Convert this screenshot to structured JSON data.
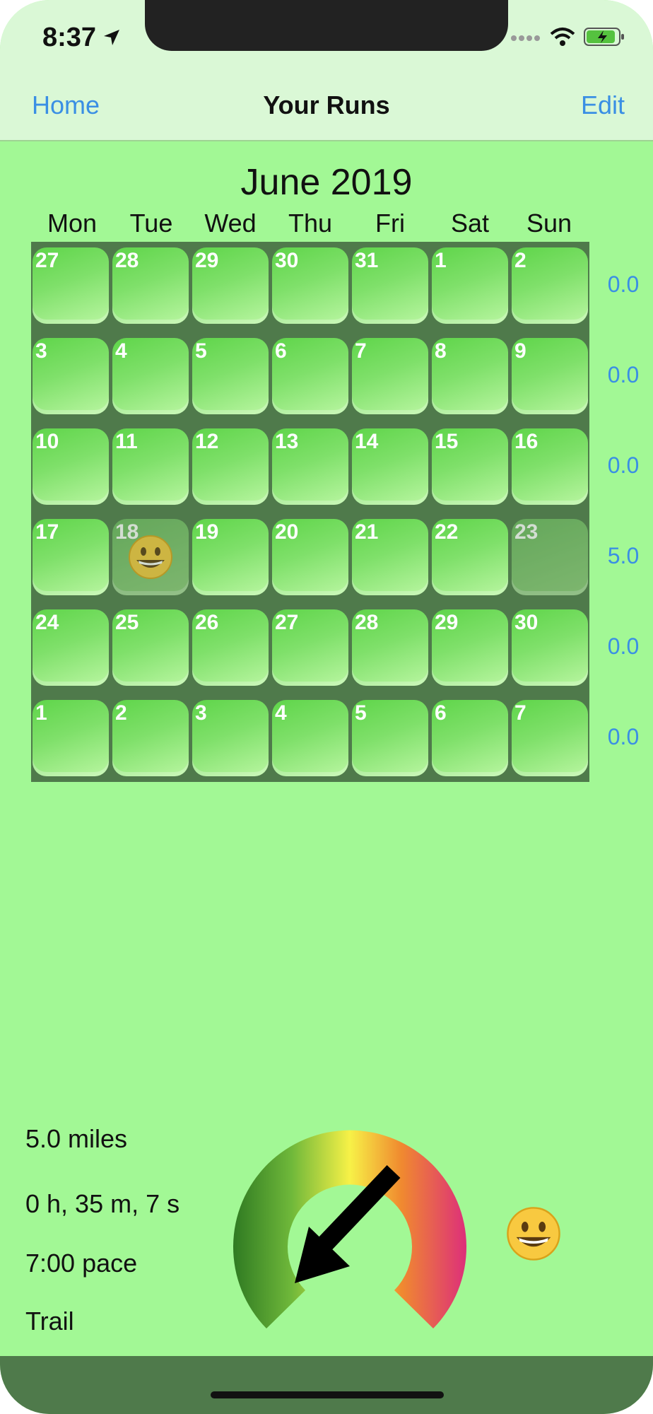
{
  "status": {
    "time": "8:37"
  },
  "nav": {
    "left": "Home",
    "title": "Your Runs",
    "right": "Edit"
  },
  "calendar": {
    "month": "June 2019",
    "weekdays": [
      "Mon",
      "Tue",
      "Wed",
      "Thu",
      "Fri",
      "Sat",
      "Sun"
    ],
    "weeks": [
      [
        "27",
        "28",
        "29",
        "30",
        "31",
        "1",
        "2"
      ],
      [
        "3",
        "4",
        "5",
        "6",
        "7",
        "8",
        "9"
      ],
      [
        "10",
        "11",
        "12",
        "13",
        "14",
        "15",
        "16"
      ],
      [
        "17",
        "18",
        "19",
        "20",
        "21",
        "22",
        "23"
      ],
      [
        "24",
        "25",
        "26",
        "27",
        "28",
        "29",
        "30"
      ],
      [
        "1",
        "2",
        "3",
        "4",
        "5",
        "6",
        "7"
      ]
    ],
    "weekly_totals": [
      "0.0",
      "0.0",
      "0.0",
      "5.0",
      "0.0",
      "0.0"
    ],
    "marked_days": [
      {
        "week": 3,
        "day": 1,
        "icon": "grinning-face-icon"
      }
    ],
    "dimmed_days": [
      {
        "week": 3,
        "day": 1
      },
      {
        "week": 3,
        "day": 6
      }
    ]
  },
  "run": {
    "distance": "5.0 miles",
    "duration": "0 h, 35 m, 7 s",
    "pace": "7:00 pace",
    "surface": "Trail",
    "mood_icon": "grinning-face-icon"
  },
  "colors": {
    "background": "#a2f895",
    "bar": "#daf8d6",
    "accent": "#3a8fe4",
    "grid": "#4f7a4b"
  }
}
